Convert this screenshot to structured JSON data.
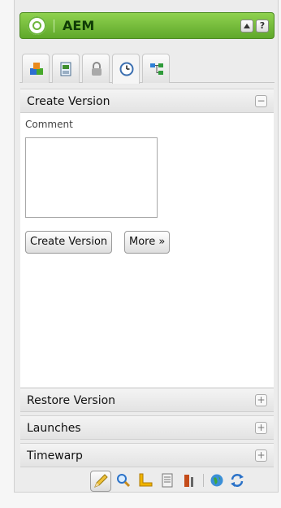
{
  "app": {
    "title": "AEM"
  },
  "title_bar": {
    "collapse_icon": "triangle-up-icon",
    "help_label": "?"
  },
  "tabs": [
    {
      "name": "components",
      "icon": "components-icon",
      "active": false
    },
    {
      "name": "page",
      "icon": "page-icon",
      "active": false
    },
    {
      "name": "workflow",
      "icon": "lock-icon",
      "active": false
    },
    {
      "name": "versioning",
      "icon": "clock-icon",
      "active": true
    },
    {
      "name": "tree",
      "icon": "tree-icon",
      "active": false
    }
  ],
  "create_version": {
    "header": "Create Version",
    "toggle": "−",
    "comment_label": "Comment",
    "comment_value": "",
    "create_button": "Create Version",
    "more_button": "More »"
  },
  "collapsed_panels": [
    {
      "label": "Restore Version",
      "toggle": "+"
    },
    {
      "label": "Launches",
      "toggle": "+"
    },
    {
      "label": "Timewarp",
      "toggle": "+"
    }
  ],
  "toolbar": [
    {
      "icon": "pencil-icon",
      "active": true
    },
    {
      "icon": "magnifier-icon"
    },
    {
      "icon": "ruler-icon"
    },
    {
      "icon": "document-icon"
    },
    {
      "icon": "design-icon"
    },
    {
      "icon": "globe-icon"
    },
    {
      "icon": "refresh-icon"
    }
  ],
  "colors": {
    "brand_green": "#6cb53b",
    "title_text": "#0f3b06"
  }
}
